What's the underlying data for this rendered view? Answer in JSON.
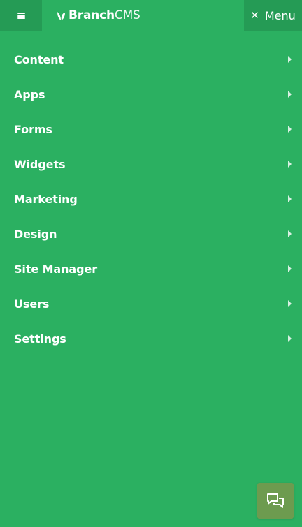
{
  "header": {
    "logo_strong": "Branch",
    "logo_light": "CMS",
    "menu_label": "Menu",
    "close_glyph": "✕"
  },
  "nav": {
    "items": [
      {
        "label": "Content"
      },
      {
        "label": "Apps"
      },
      {
        "label": "Forms"
      },
      {
        "label": "Widgets"
      },
      {
        "label": "Marketing"
      },
      {
        "label": "Design"
      },
      {
        "label": "Site Manager"
      },
      {
        "label": "Users"
      },
      {
        "label": "Settings"
      }
    ]
  },
  "icons": {
    "hamburger": "hamburger-icon",
    "logo": "leaf-icon",
    "close": "close-icon",
    "caret": "chevron-right-icon",
    "chat": "chat-icon"
  },
  "colors": {
    "background": "#2bb061",
    "header_button": "#259b55",
    "chat_button": "#6d9b4f",
    "text": "#ffffff"
  }
}
